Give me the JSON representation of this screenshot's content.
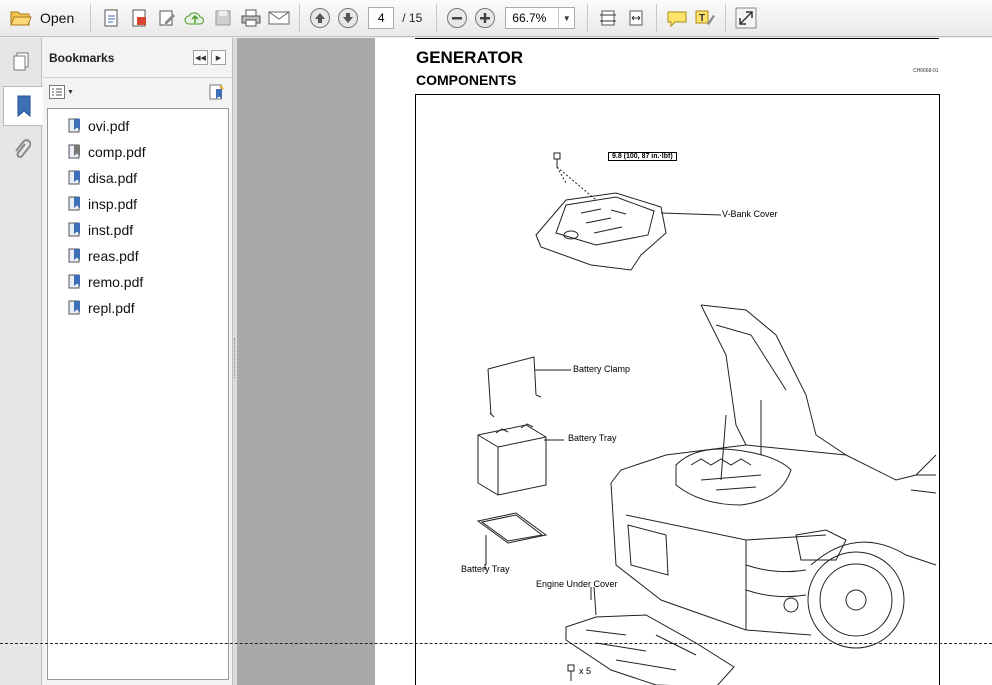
{
  "toolbar": {
    "open_label": "Open",
    "page_current": "4",
    "page_total": "/ 15",
    "zoom_value": "66.7%",
    "icons": [
      "open-folder-icon",
      "create-pdf-icon",
      "combine-icon",
      "edit-icon",
      "upload-cloud-icon",
      "save-icon",
      "print-icon",
      "email-icon",
      "previous-page-icon",
      "next-page-icon",
      "zoom-out-icon",
      "zoom-in-icon",
      "fit-page-icon",
      "fit-width-icon",
      "comment-icon",
      "highlight-icon",
      "fullscreen-icon"
    ]
  },
  "navstrip": {
    "icons": [
      "pages-icon",
      "bookmarks-icon",
      "attachments-icon"
    ]
  },
  "bookmarks": {
    "title": "Bookmarks",
    "items": [
      {
        "label": "ovi.pdf"
      },
      {
        "label": "comp.pdf"
      },
      {
        "label": "disa.pdf"
      },
      {
        "label": "insp.pdf"
      },
      {
        "label": "inst.pdf"
      },
      {
        "label": "reas.pdf"
      },
      {
        "label": "remo.pdf"
      },
      {
        "label": "repl.pdf"
      }
    ]
  },
  "document": {
    "title": "GENERATOR",
    "subtitle": "COMPONENTS",
    "figure_code": "CH6668-01",
    "labels": {
      "torque": "9.8 (100, 87 in.·lbf)",
      "vbank_cover": "V-Bank  Cover",
      "battery_clamp": "Battery Clamp",
      "battery_tray_top": "Battery Tray",
      "battery_tray_bottom": "Battery Tray",
      "engine_under_cover": "Engine Under Cover",
      "times_five": "x 5"
    }
  },
  "colors": {
    "toolbar_bg": "#ececec",
    "doc_bg": "#a9a9a9",
    "icon_blue": "#3d6fb6"
  }
}
